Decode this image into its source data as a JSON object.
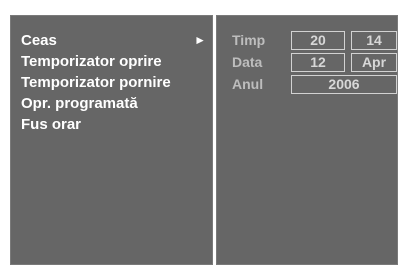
{
  "menu": {
    "items": [
      {
        "label": "Ceas",
        "arrow": "►"
      },
      {
        "label": "Temporizator oprire"
      },
      {
        "label": "Temporizator pornire"
      },
      {
        "label": "Opr. programată"
      },
      {
        "label": "Fus orar"
      }
    ]
  },
  "settings": {
    "time": {
      "label": "Timp",
      "hour": "20",
      "minute": "14"
    },
    "date": {
      "label": "Data",
      "day": "12",
      "month": "Apr"
    },
    "year": {
      "label": "Anul",
      "value": "2006"
    }
  },
  "colors": {
    "panel_background": "#666666",
    "panel_border": "#7a7a7a",
    "menu_text": "#ffffff",
    "field_label": "#bdbdbd",
    "field_value": "#d7d7d7",
    "field_border": "#d2d2d2"
  }
}
